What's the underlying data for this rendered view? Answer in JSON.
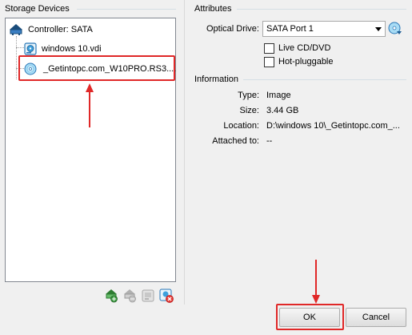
{
  "storage": {
    "title": "Storage Devices",
    "controller": "Controller: SATA",
    "items": [
      {
        "label": "windows 10.vdi",
        "icon": "hard-disk-icon"
      },
      {
        "label": "_Getintopc.com_W10PRO.RS3....",
        "icon": "optical-disc-icon"
      }
    ]
  },
  "attributes": {
    "title": "Attributes",
    "optical_drive_label": "Optical Drive:",
    "optical_drive_value": "SATA Port 1",
    "live_cd_label": "Live CD/DVD",
    "hot_pluggable_label": "Hot-pluggable"
  },
  "information": {
    "title": "Information",
    "rows": [
      {
        "label": "Type:",
        "value": "Image"
      },
      {
        "label": "Size:",
        "value": "3.44 GB"
      },
      {
        "label": "Location:",
        "value": "D:\\windows 10\\_Getintopc.com_..."
      },
      {
        "label": "Attached to:",
        "value": "--"
      }
    ]
  },
  "buttons": {
    "ok": "OK",
    "cancel": "Cancel"
  },
  "colors": {
    "annotation_red": "#e02828",
    "accent_blue": "#3ca0dc"
  }
}
